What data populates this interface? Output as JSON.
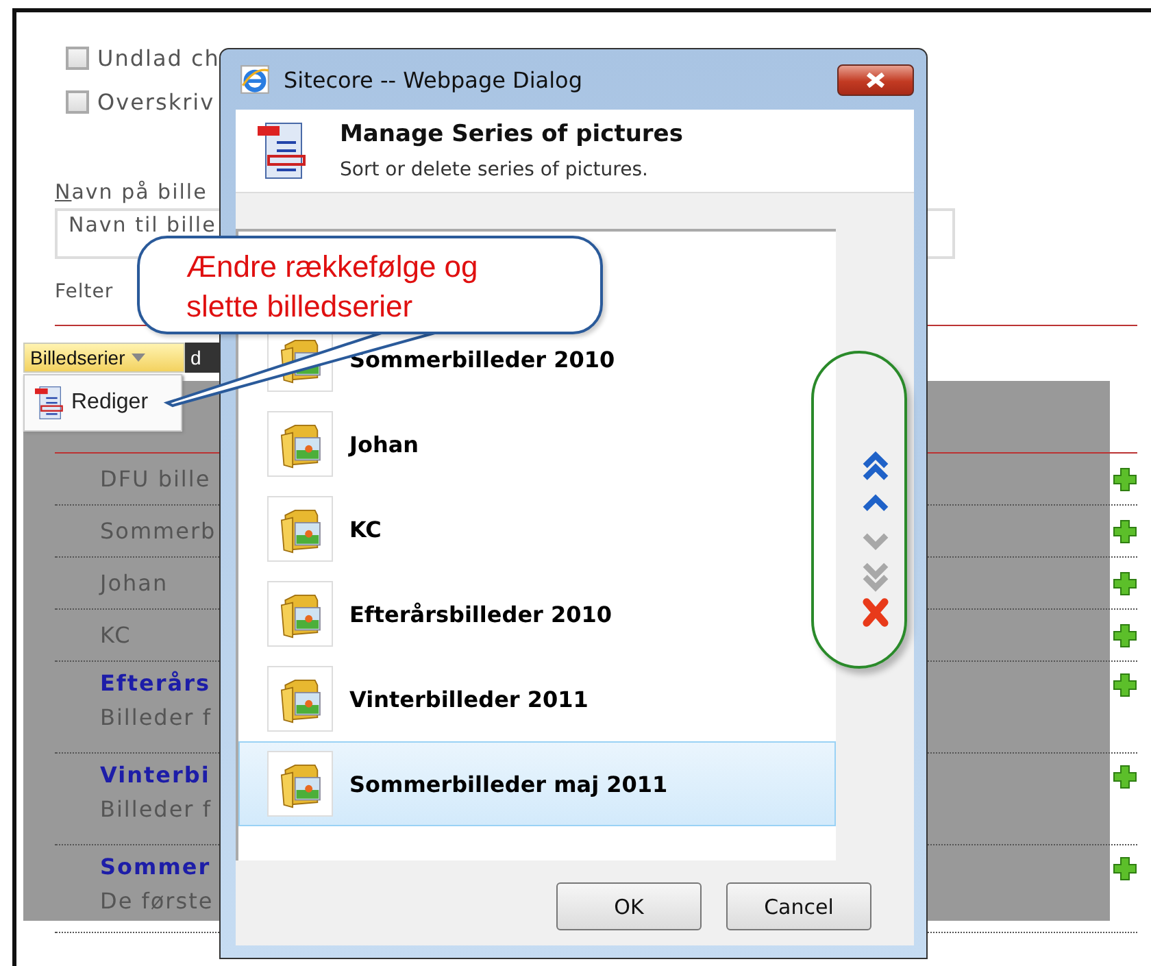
{
  "page": {
    "checkboxes": [
      {
        "label": "Undlad ch",
        "checked": false
      },
      {
        "label": "Overskriv",
        "checked": false
      }
    ],
    "name_label": "Navn på bille",
    "name_field": {
      "placeholder": "Navn til bille"
    },
    "fields_label": "Felter",
    "toolbar": {
      "dropdown": "Billedserier",
      "tab": "d"
    },
    "menu": {
      "items": [
        {
          "label": "Rediger"
        }
      ]
    },
    "series": [
      {
        "kind": "plain",
        "title": "DFU bille"
      },
      {
        "kind": "plain",
        "title": "Sommerb"
      },
      {
        "kind": "plain",
        "title": "Johan"
      },
      {
        "kind": "plain",
        "title": "KC"
      },
      {
        "kind": "titled",
        "title": "Efterårs",
        "description": "Billeder f"
      },
      {
        "kind": "titled",
        "title": "Vinterbi",
        "description": "Billeder f"
      },
      {
        "kind": "titled",
        "title": "Sommer",
        "description": "De første"
      }
    ]
  },
  "dialog": {
    "title": "Sitecore -- Webpage Dialog",
    "heading": "Manage Series of pictures",
    "subheading": "Sort or delete series of pictures.",
    "items": [
      {
        "label": "Sommerbilleder 2010",
        "selected": false
      },
      {
        "label": "Johan",
        "selected": false
      },
      {
        "label": "KC",
        "selected": false
      },
      {
        "label": "Efterårsbilleder 2010",
        "selected": false
      },
      {
        "label": "Vinterbilleder 2011",
        "selected": false
      },
      {
        "label": "Sommerbilleder maj 2011",
        "selected": true
      }
    ],
    "sort_buttons": [
      {
        "kind": "top",
        "disabled": false
      },
      {
        "kind": "up",
        "disabled": false
      },
      {
        "kind": "down",
        "disabled": true
      },
      {
        "kind": "bottom",
        "disabled": true
      },
      {
        "kind": "delete",
        "disabled": false
      }
    ],
    "buttons": [
      "OK",
      "Cancel"
    ]
  },
  "callout": {
    "text": "Ændre rækkefølge og slette billedserier"
  }
}
